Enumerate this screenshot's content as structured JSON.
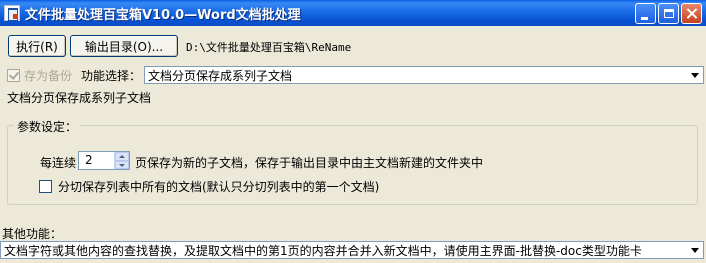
{
  "window": {
    "title": "文件批量处理百宝箱V10.0—Word文档批处理",
    "icon": "app-doc-icon"
  },
  "toolbar": {
    "execute_label": "执行(R)",
    "output_dir_label": "输出目录(O)...",
    "output_path": "D:\\文件批量处理百宝箱\\ReName"
  },
  "options": {
    "backup_label": "存为备份",
    "backup_checked": true,
    "backup_enabled": false,
    "function_label": "功能选择：",
    "function_value": "文档分页保存成系列子文档",
    "function_description": "文档分页保存成系列子文档"
  },
  "params": {
    "group_title": "参数设定：",
    "every_label": "每连续",
    "every_value": "2",
    "every_text": "页保存为新的子文档，保存于输出目录中由主文档新建的文件夹中",
    "split_label": "分切保存列表中所有的文档(默认只分切列表中的第一个文档)",
    "split_checked": false
  },
  "other": {
    "label": "其他功能：",
    "value": "文档字符或其他内容的查找替换，及提取文档中的第1页的内容并合并入新文档中，请使用主界面-批替换-doc类型功能卡"
  }
}
